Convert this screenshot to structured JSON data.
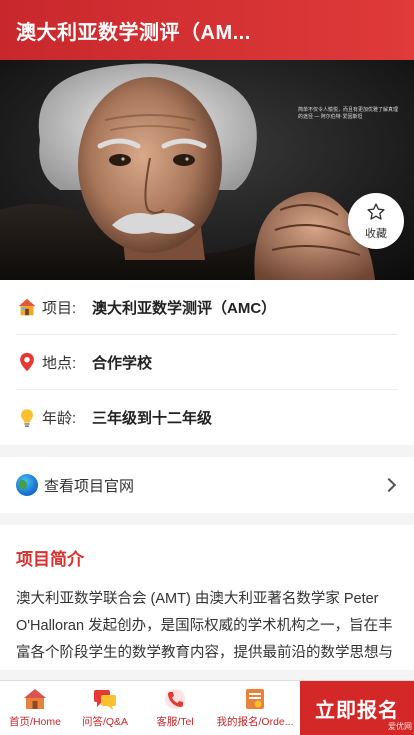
{
  "header": {
    "title": "澳大利亚数学测评（AM..."
  },
  "hero": {
    "quote": "简单不仅令人愉悦，而且有更加优雅了解真理的途径 — 阿尔伯特·爱因斯坦"
  },
  "favorite": {
    "label": "收藏",
    "icon": "star-outline-icon"
  },
  "info": {
    "project": {
      "key": "项目:",
      "value": "澳大利亚数学测评（AMC）",
      "icon": "house-icon"
    },
    "location": {
      "key": "地点:",
      "value": "合作学校",
      "icon": "map-pin-icon"
    },
    "age": {
      "key": "年龄:",
      "value": "三年级到十二年级",
      "icon": "lightbulb-icon"
    }
  },
  "official_link": {
    "label": "查看项目官网",
    "icon": "globe-icon"
  },
  "intro": {
    "title": "项目简介",
    "body": "澳大利亚数学联合会 (AMT) 由澳大利亚著名数学家 Peter O'Halloran 发起创办，是国际权威的学术机构之一，旨在丰富各个阶段学生的数学教育内容，提供最前沿的数学思想与方法。"
  },
  "tabbar": {
    "home": "首页/Home",
    "qa": "问答/Q&A",
    "service": "客服/Tel",
    "my_orders": "我的报名/Orde...",
    "cta": "立即报名",
    "watermark": "爱优网"
  },
  "colors": {
    "brand_red": "#d42828",
    "accent_red": "#d93030"
  }
}
